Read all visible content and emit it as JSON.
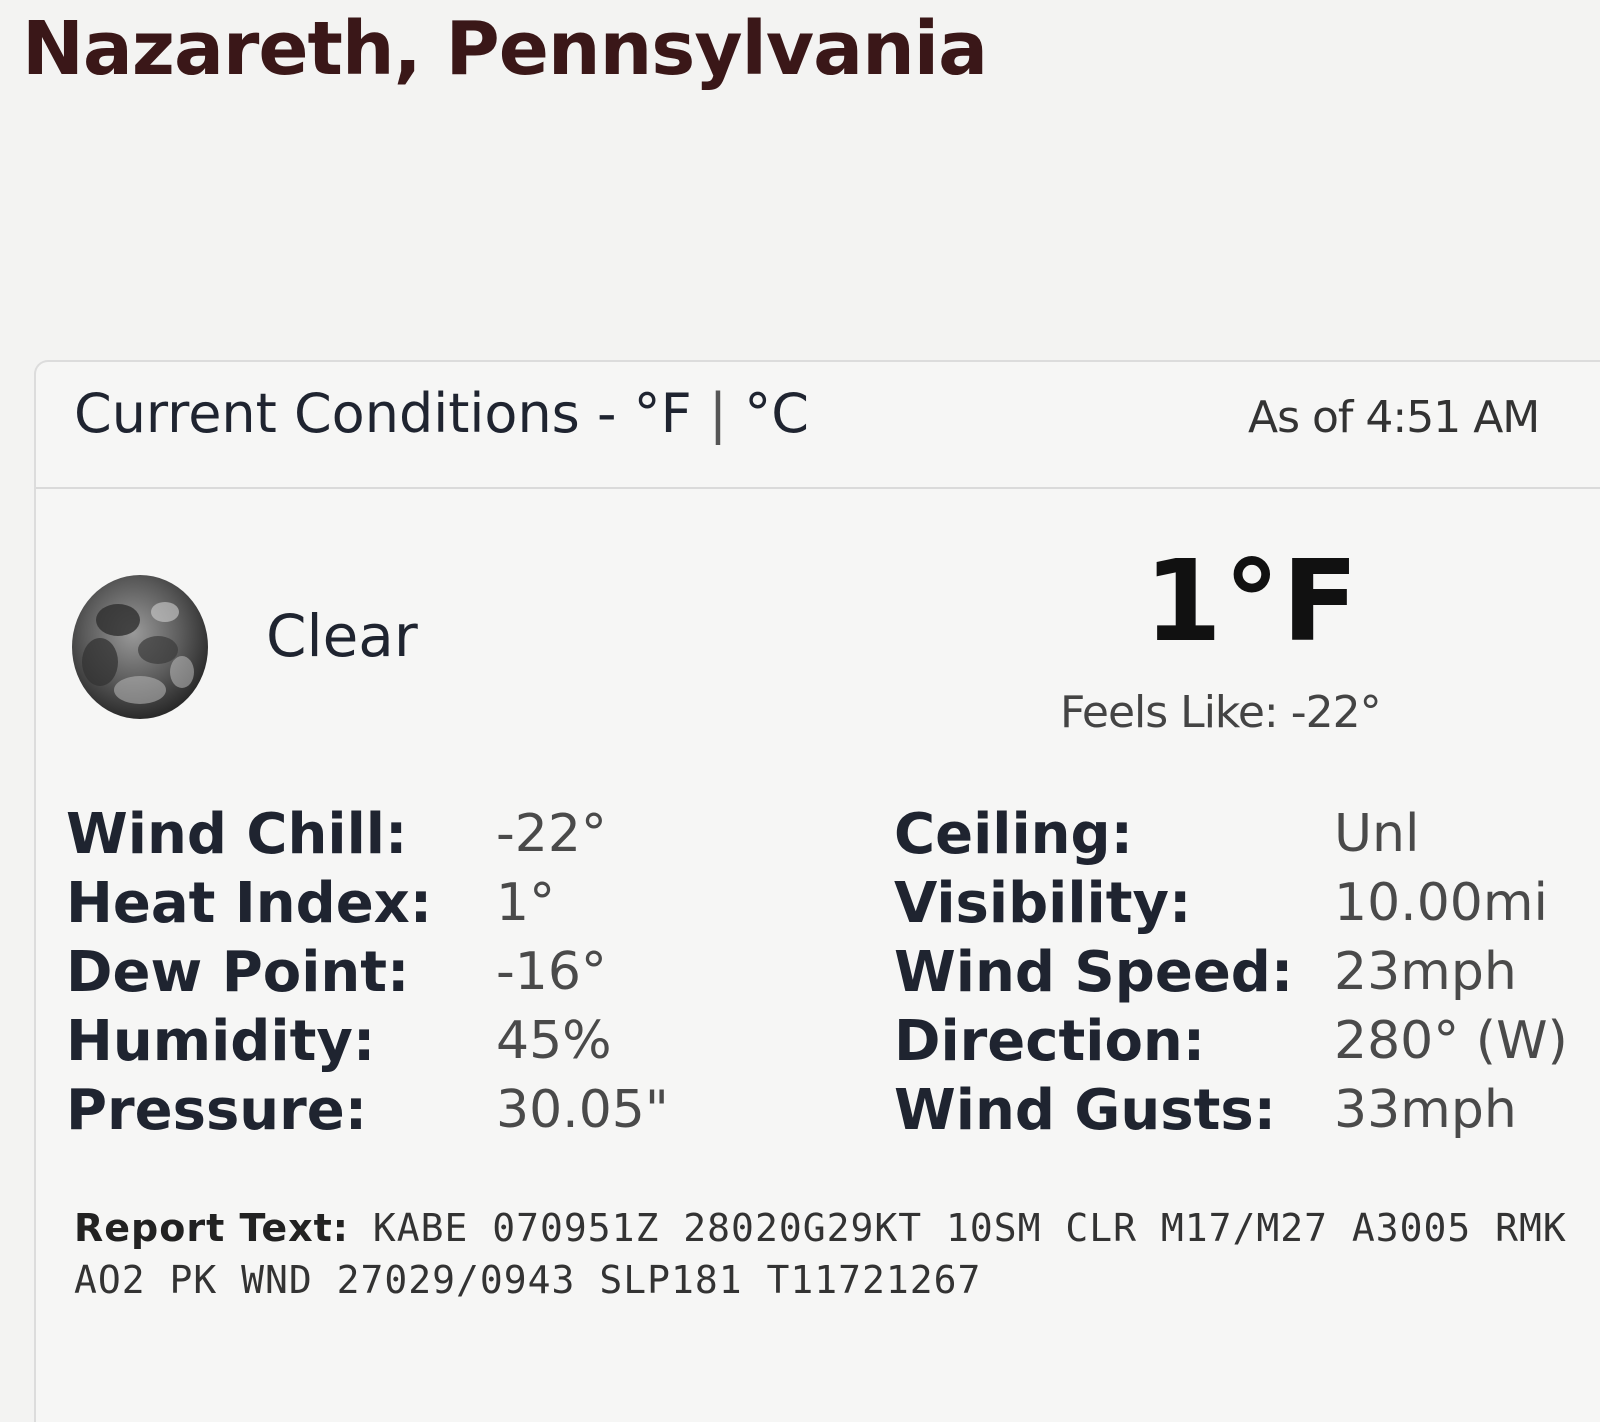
{
  "location": "Nazareth, Pennsylvania",
  "header": {
    "title": "Current Conditions",
    "dash": " - ",
    "unit_f": "°F",
    "separator": " | ",
    "unit_c": "°C",
    "as_of": "As of 4:51 AM"
  },
  "current": {
    "icon": "moon-icon",
    "condition": "Clear",
    "temperature": "1°F",
    "feels_like": "Feels Like: -22°"
  },
  "left_details": [
    {
      "label": "Wind Chill:",
      "value": "-22°"
    },
    {
      "label": "Heat Index:",
      "value": "1°"
    },
    {
      "label": "Dew Point:",
      "value": "-16°"
    },
    {
      "label": "Humidity:",
      "value": "45%"
    },
    {
      "label": "Pressure:",
      "value": "30.05\""
    }
  ],
  "right_details": [
    {
      "label": "Ceiling:",
      "value": "Unl"
    },
    {
      "label": "Visibility:",
      "value": "10.00mi"
    },
    {
      "label": "Wind Speed:",
      "value": "23mph"
    },
    {
      "label": "Direction:",
      "value": "280° (W)"
    },
    {
      "label": "Wind Gusts:",
      "value": "33mph"
    }
  ],
  "report": {
    "label": "Report Text:",
    "text": "KABE 070951Z 28020G29KT 10SM CLR M17/M27 A3005 RMK AO2 PK WND 27029/0943 SLP181 T11721267"
  }
}
